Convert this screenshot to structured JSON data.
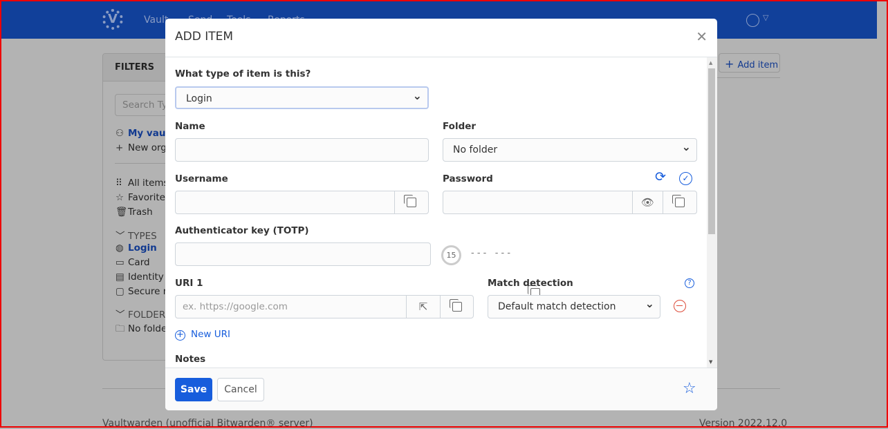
{
  "navbar": {
    "brand": "Vaultwarden",
    "items": [
      "Vault",
      "Send",
      "Tools",
      "Reports"
    ],
    "account_icon": "user-circle-icon"
  },
  "filters": {
    "title": "FILTERS",
    "search_placeholder": "Search Types",
    "my_vault": "My vault",
    "new_org": "New organization",
    "all_items": "All items",
    "favorites": "Favorites",
    "trash": "Trash",
    "types_header": "TYPES",
    "types": [
      "Login",
      "Card",
      "Identity",
      "Secure note"
    ],
    "folders_header": "FOLDERS",
    "no_folder": "No folder"
  },
  "add_item_button": "Add item",
  "footer": {
    "left": "Vaultwarden (unofficial Bitwarden® server)",
    "right": "Version 2022.12.0"
  },
  "modal": {
    "title": "ADD ITEM",
    "type_label": "What type of item is this?",
    "type_value": "Login",
    "name_label": "Name",
    "name_value": "",
    "folder_label": "Folder",
    "folder_value": "No folder",
    "username_label": "Username",
    "username_value": "",
    "password_label": "Password",
    "password_value": "",
    "totp_label": "Authenticator key (TOTP)",
    "totp_value": "",
    "totp_countdown": "15",
    "totp_code": "- - -   - - -",
    "uri_label": "URI 1",
    "uri_placeholder": "ex. https://google.com",
    "match_label": "Match detection",
    "match_value": "Default match detection",
    "new_uri": "New URI",
    "notes_label": "Notes",
    "save": "Save",
    "cancel": "Cancel"
  },
  "colors": {
    "primary": "#175ddc",
    "navbar": "#11409a",
    "danger": "#dd4b39"
  }
}
